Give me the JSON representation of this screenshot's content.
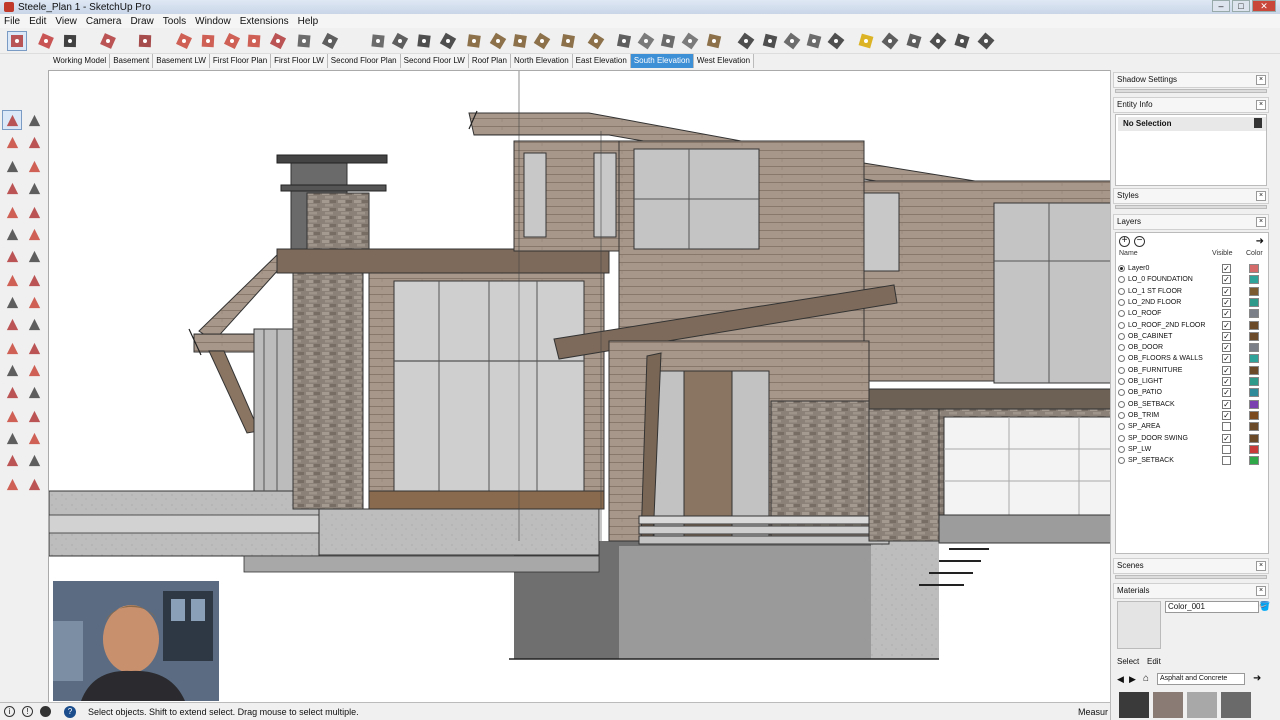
{
  "window": {
    "title": "Steele_Plan 1 - SketchUp Pro"
  },
  "menu": [
    "File",
    "Edit",
    "View",
    "Camera",
    "Draw",
    "Tools",
    "Window",
    "Extensions",
    "Help"
  ],
  "scene_tabs": [
    "Working Model",
    "Basement",
    "Basement LW",
    "First Floor Plan",
    "First Floor LW",
    "Second Floor Plan",
    "Second Floor LW",
    "Roof Plan",
    "North Elevation",
    "East Elevation",
    "South Elevation",
    "West Elevation"
  ],
  "active_tab": "South Elevation",
  "tray": {
    "shadow_settings": "Shadow Settings",
    "entity_info": "Entity Info",
    "no_selection": "No Selection",
    "styles": "Styles",
    "layers_title": "Layers",
    "col_name": "Name",
    "col_visible": "Visible",
    "col_color": "Color",
    "scenes": "Scenes",
    "materials_title": "Materials",
    "material_name": "Color_001",
    "select_tab": "Select",
    "edit_tab": "Edit",
    "collection": "Asphalt and Concrete"
  },
  "layers": [
    {
      "name": "Layer0",
      "active": true,
      "visible": true,
      "color": "#d46a6a"
    },
    {
      "name": "LO_0 FOUNDATION",
      "active": false,
      "visible": true,
      "color": "#2fa29a"
    },
    {
      "name": "LO_1 ST FLOOR",
      "active": false,
      "visible": true,
      "color": "#7a5a2e"
    },
    {
      "name": "LO_2ND FLOOR",
      "active": false,
      "visible": true,
      "color": "#2f9a8a"
    },
    {
      "name": "LO_ROOF",
      "active": false,
      "visible": true,
      "color": "#7a7f88"
    },
    {
      "name": "LO_ROOF_2ND FLOOR",
      "active": false,
      "visible": true,
      "color": "#6b4a2a"
    },
    {
      "name": "OB_CABINET",
      "active": false,
      "visible": true,
      "color": "#6b4a2a"
    },
    {
      "name": "OB_DOOR",
      "active": false,
      "visible": true,
      "color": "#7a7f88"
    },
    {
      "name": "OB_FLOORS & WALLS",
      "active": false,
      "visible": true,
      "color": "#2fa29a"
    },
    {
      "name": "OB_FURNITURE",
      "active": false,
      "visible": true,
      "color": "#6b4a2a"
    },
    {
      "name": "OB_LIGHT",
      "active": false,
      "visible": true,
      "color": "#2f9a8a"
    },
    {
      "name": "OB_PATIO",
      "active": false,
      "visible": true,
      "color": "#2f8a9a"
    },
    {
      "name": "OB_SETBACK",
      "active": false,
      "visible": true,
      "color": "#7a40b0"
    },
    {
      "name": "OB_TRIM",
      "active": false,
      "visible": true,
      "color": "#7a4a1e"
    },
    {
      "name": "SP_AREA",
      "active": false,
      "visible": false,
      "color": "#6b4a2a"
    },
    {
      "name": "SP_DOOR SWING",
      "active": false,
      "visible": true,
      "color": "#6b4a2a"
    },
    {
      "name": "SP_LW",
      "active": false,
      "visible": false,
      "color": "#c83a3a"
    },
    {
      "name": "SP_SETBACK",
      "active": false,
      "visible": false,
      "color": "#2fa84a"
    }
  ],
  "status": {
    "message": "Select objects. Shift to extend select. Drag mouse to select multiple.",
    "measurements": "Measur"
  },
  "icons": {
    "toolbar": [
      "select-icon",
      "eraser-icon",
      "pencil-icon",
      "arc-icon",
      "rectangle-icon",
      "push-pull-icon",
      "follow-me-icon",
      "move-icon",
      "rotate-icon",
      "scale-icon",
      "tape-measure-icon",
      "text-icon",
      "orbit-icon",
      "pan-icon",
      "zoom-icon",
      "zoom-extents-icon",
      "iso-view-icon",
      "top-view-icon",
      "front-view-icon",
      "right-view-icon",
      "back-view-icon",
      "left-view-icon",
      "xray-icon",
      "wireframe-icon",
      "hidden-line-icon",
      "shaded-icon",
      "textured-icon",
      "monochrome-icon",
      "shadows-icon",
      "fog-icon",
      "section-plane-icon",
      "sound-icon",
      "light-icon",
      "warehouse-icon",
      "extension-icon",
      "home-icon",
      "house-icon",
      "house-outline-icon",
      "building-icon"
    ]
  }
}
